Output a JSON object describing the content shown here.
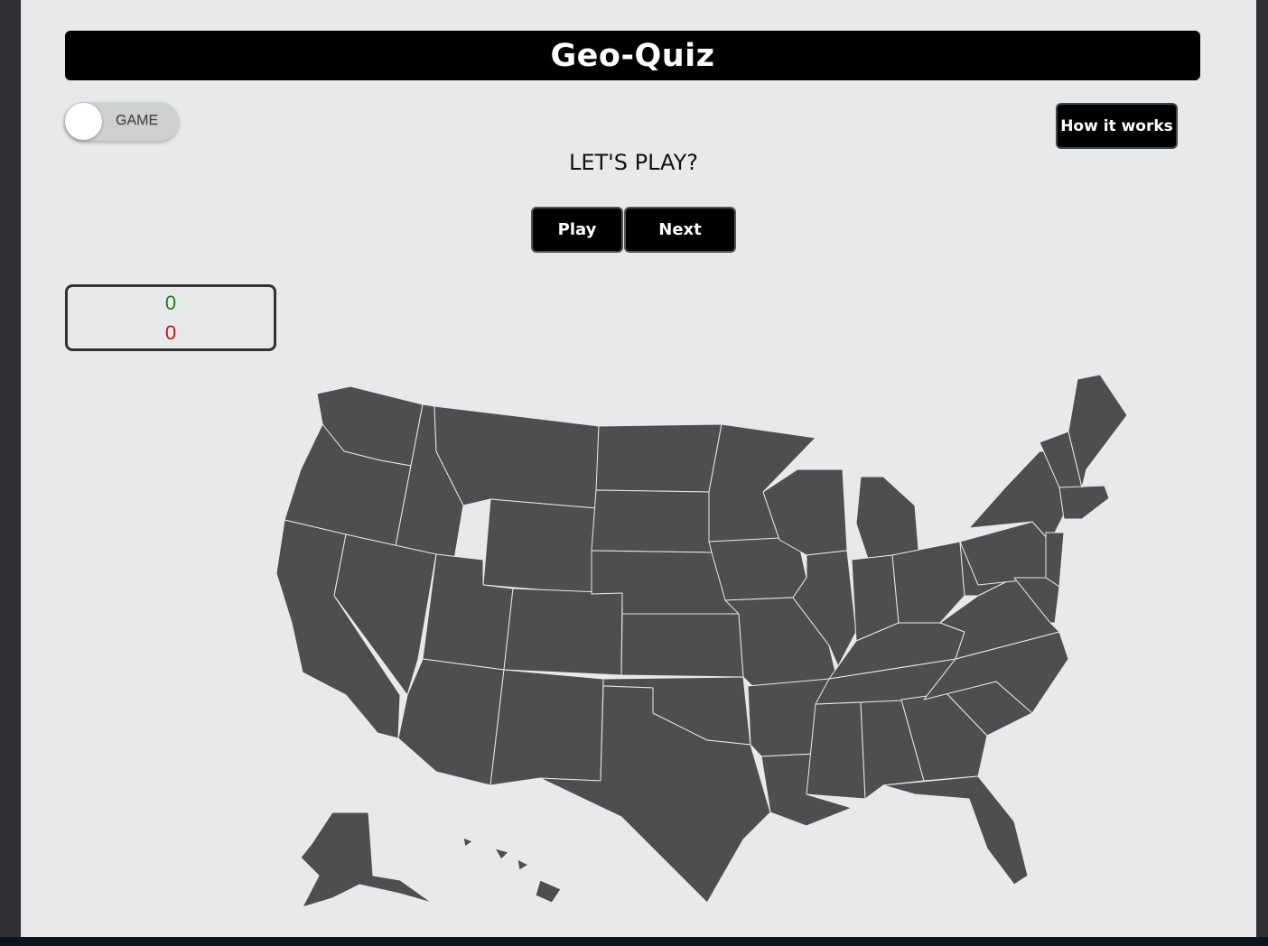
{
  "app": {
    "title": "Geo-Quiz"
  },
  "toggle": {
    "label": "GAME",
    "state": "off"
  },
  "header": {
    "how_label": "How it works"
  },
  "prompt": {
    "text": "LET'S PLAY?"
  },
  "actions": {
    "play_label": "Play",
    "next_label": "Next"
  },
  "score": {
    "correct": "0",
    "wrong": "0"
  },
  "colors": {
    "background": "#e8e9eb",
    "title_bar": "#000000",
    "state_fill": "#4d4f4e",
    "correct": "#1e7d1e",
    "wrong": "#c81818"
  }
}
